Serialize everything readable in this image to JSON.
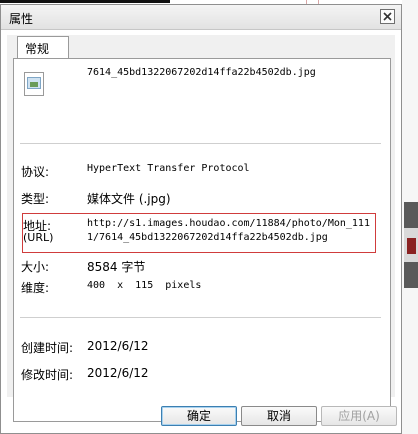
{
  "dialog": {
    "title": "属性",
    "close_symbol": "X",
    "tab_label": "常规",
    "file_name": "7614_45bd1322067202d14ffa22b4502db.jpg",
    "properties": {
      "protocol_label": "协议:",
      "protocol_value": "HyperText Transfer Protocol",
      "type_label": "类型:",
      "type_value": "媒体文件 (.jpg)",
      "address_label": "地址:",
      "address_label_sub": "(URL)",
      "address_line1": "http://s1.images.houdao.com/11884/photo/Mon_111",
      "address_line2": "1/7614_45bd1322067202d14ffa22b4502db.jpg",
      "size_label": "大小:",
      "size_value": "8584 字节",
      "dimensions_label": "维度:",
      "dimensions_value": "400  x  115  pixels",
      "created_label": "创建时间:",
      "created_value": "2012/6/12",
      "modified_label": "修改时间:",
      "modified_value": "2012/6/12"
    },
    "buttons": {
      "ok": "确定",
      "cancel": "取消",
      "apply": "应用(A)"
    }
  },
  "colors": {
    "highlight_box": "#d03c3c",
    "ok_button_border": "#3c7fb1"
  }
}
